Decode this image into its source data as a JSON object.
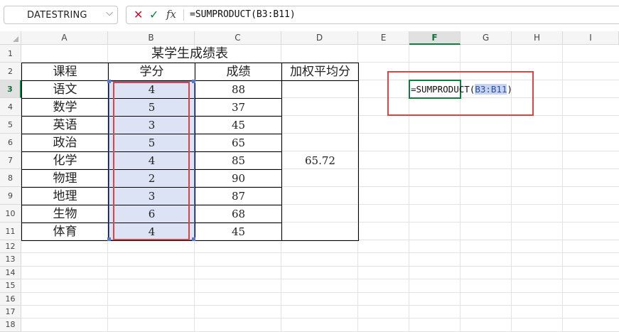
{
  "namebox": {
    "value": "DATESTRING"
  },
  "formula_bar": {
    "formula": "=SUMPRODUCT(B3:B11)",
    "fx_label": "fx"
  },
  "columns": [
    "A",
    "B",
    "C",
    "D",
    "E",
    "F",
    "G",
    "H",
    "I"
  ],
  "active_column": "F",
  "active_row": "3",
  "rows": [
    "1",
    "2",
    "3",
    "4",
    "5",
    "6",
    "7",
    "8",
    "9",
    "10",
    "11",
    "12",
    "13",
    "14",
    "15",
    "16",
    "17",
    "18"
  ],
  "table": {
    "title": "某学生成绩表",
    "headers": [
      "课程",
      "学分",
      "成绩",
      "加权平均分"
    ],
    "weighted_avg": "65.72",
    "records": [
      {
        "course": "语文",
        "credit": "4",
        "score": "88"
      },
      {
        "course": "数学",
        "credit": "5",
        "score": "37"
      },
      {
        "course": "英语",
        "credit": "3",
        "score": "45"
      },
      {
        "course": "政治",
        "credit": "5",
        "score": "65"
      },
      {
        "course": "化学",
        "credit": "4",
        "score": "85"
      },
      {
        "course": "物理",
        "credit": "2",
        "score": "90"
      },
      {
        "course": "地理",
        "credit": "3",
        "score": "87"
      },
      {
        "course": "生物",
        "credit": "6",
        "score": "68"
      },
      {
        "course": "体育",
        "credit": "4",
        "score": "45"
      }
    ]
  },
  "editing_cell": {
    "prefix": "=SUMPRODUCT(",
    "range_ref": "B3:B11",
    "suffix": ")"
  },
  "colors": {
    "accent_green": "#107c41",
    "selection_fill": "#dce3f5",
    "selection_border": "#5b79c4",
    "annotation_red": "#e04141"
  }
}
